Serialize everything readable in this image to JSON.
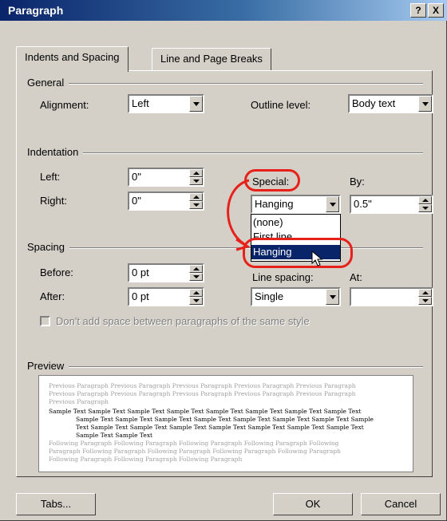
{
  "window": {
    "title": "Paragraph",
    "help_button": "?",
    "close_button": "X"
  },
  "tabs": [
    {
      "label": "Indents and Spacing",
      "active": true
    },
    {
      "label": "Line and Page Breaks",
      "active": false
    }
  ],
  "general": {
    "group_label": "General",
    "alignment_label": "Alignment:",
    "alignment_value": "Left",
    "outline_label": "Outline level:",
    "outline_value": "Body text"
  },
  "indentation": {
    "group_label": "Indentation",
    "left_label": "Left:",
    "left_value": "0\"",
    "right_label": "Right:",
    "right_value": "0\"",
    "special_label": "Special:",
    "special_value": "Hanging",
    "by_label": "By:",
    "by_value": "0.5\"",
    "special_options": [
      "(none)",
      "First line",
      "Hanging"
    ],
    "special_selected": "Hanging"
  },
  "spacing": {
    "group_label": "Spacing",
    "before_label": "Before:",
    "before_value": "0 pt",
    "after_label": "After:",
    "after_value": "0 pt",
    "line_spacing_label": "Line spacing:",
    "line_spacing_value": "Single",
    "at_label": "At:",
    "at_value": "",
    "dont_add_space_label": "Don't add space between paragraphs of the same style",
    "dont_add_space_checked": false,
    "dont_add_space_enabled": false
  },
  "preview": {
    "group_label": "Preview",
    "previous_text": "Previous Paragraph Previous Paragraph Previous Paragraph Previous Paragraph Previous Paragraph Previous Paragraph Previous Paragraph Previous Paragraph Previous Paragraph Previous Paragraph Previous Paragraph",
    "sample_first": "Sample Text Sample Text Sample Text Sample Text Sample Text Sample Text Sample Text Sample Text",
    "sample_rest": "Sample Text Sample Text Sample Text Sample Text Sample Text Sample Text Sample Text Sample Text Sample Text Sample Text Sample Text Sample Text Sample Text Sample Text Sample Text Sample Text Sample Text",
    "following_text": "Following Paragraph Following Paragraph Following Paragraph Following Paragraph Following Paragraph Following Paragraph Following Paragraph Following Paragraph Following Paragraph Following Paragraph Following Paragraph Following Paragraph"
  },
  "buttons": {
    "tabs": "Tabs...",
    "ok": "OK",
    "cancel": "Cancel"
  },
  "colors": {
    "annotation": "#e8201a",
    "titlebar": "#0a246a",
    "dialog_bg": "#d4d0c8"
  }
}
